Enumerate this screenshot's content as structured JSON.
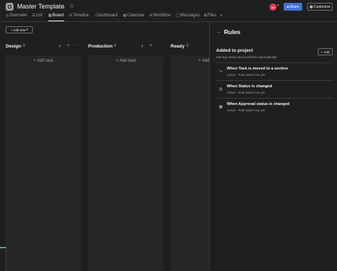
{
  "header": {
    "project_title": "Master Template",
    "avatar_initials": "AA",
    "share_label": "Share",
    "customize_label": "Customize"
  },
  "tabs": [
    {
      "label": "Overview",
      "icon": "overview-icon"
    },
    {
      "label": "List",
      "icon": "list-icon"
    },
    {
      "label": "Board",
      "icon": "board-icon",
      "active": true
    },
    {
      "label": "Timeline",
      "icon": "timeline-icon"
    },
    {
      "label": "Dashboard",
      "icon": "dashboard-icon"
    },
    {
      "label": "Calendar",
      "icon": "calendar-icon"
    },
    {
      "label": "Workflow",
      "icon": "workflow-icon"
    },
    {
      "label": "Messages",
      "icon": "messages-icon"
    },
    {
      "label": "Files",
      "icon": "files-icon"
    }
  ],
  "toolbar": {
    "add_new_label": "Add new"
  },
  "board": {
    "columns": [
      {
        "title": "Design",
        "count": "0",
        "add_task_label": "Add task"
      },
      {
        "title": "Production",
        "count": "0",
        "add_task_label": "Add task"
      },
      {
        "title": "Ready",
        "count": "0",
        "add_task_label": "Add task"
      }
    ]
  },
  "rules_panel": {
    "title": "Rules",
    "section_title": "Added to project",
    "section_subtitle": "Manage tasks and workflows automatically.",
    "add_label": "Add",
    "rules": [
      {
        "name": "When Task is moved to a section",
        "status": "Active · Rule hasn't run yet"
      },
      {
        "name": "When Status is changed",
        "status": "Active · Rule hasn't run yet"
      },
      {
        "name": "When Approval status is changed",
        "status": "Active · Rule hasn't run yet"
      }
    ]
  },
  "colors": {
    "background": "#1e1f21",
    "column_background": "#252628",
    "share_button": "#4573d2",
    "avatar": "#e8384f",
    "accent_green": "#5da283"
  }
}
